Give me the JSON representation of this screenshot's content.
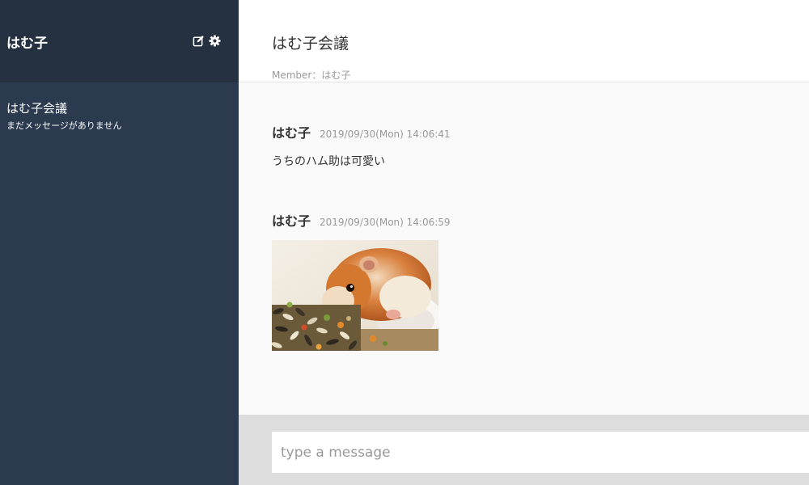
{
  "sidebar": {
    "user_name": "はむ子",
    "edit_icon": "edit-icon",
    "settings_icon": "gear-icon",
    "groups": [
      {
        "name": "はむ子会議",
        "latest_message": "まだメッセージがありません"
      }
    ]
  },
  "chat": {
    "title": "はむ子会議",
    "members": "Member：はむ子",
    "messages": [
      {
        "user": "はむ子",
        "date": "2019/09/30(Mon) 14:06:41",
        "text": "うちのハム助は可愛い"
      },
      {
        "user": "はむ子",
        "date": "2019/09/30(Mon) 14:06:59",
        "image": "hamster-photo"
      }
    ]
  },
  "form": {
    "placeholder": "type a message"
  },
  "colors": {
    "sidebar_bg": "#2b3a4f",
    "sidebar_header_bg": "#253141",
    "main_bg": "#fafafa",
    "form_bg": "#dddddd"
  }
}
